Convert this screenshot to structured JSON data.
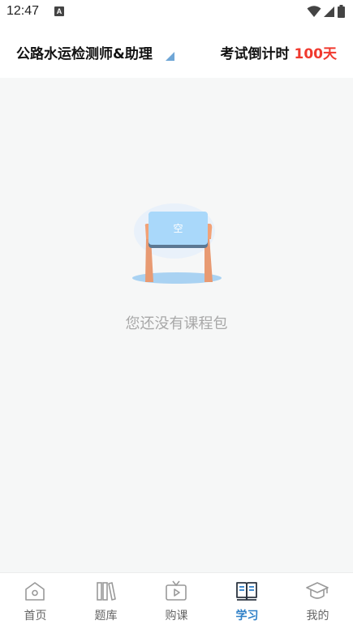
{
  "status_bar": {
    "time": "12:47",
    "notification_letter": "A"
  },
  "header": {
    "exam_title": "公路水运检测师&助理",
    "countdown_label": "考试倒计时",
    "countdown_days": "100天"
  },
  "empty_state": {
    "sign_text": "空",
    "message": "您还没有课程包"
  },
  "tabbar": {
    "tabs": [
      {
        "label": "首页",
        "icon": "home-icon"
      },
      {
        "label": "题库",
        "icon": "books-icon"
      },
      {
        "label": "购课",
        "icon": "tv-play-icon"
      },
      {
        "label": "学习",
        "icon": "open-book-icon",
        "active": true
      },
      {
        "label": "我的",
        "icon": "graduation-cap-icon"
      }
    ]
  },
  "colors": {
    "accent": "#2f80c8",
    "countdown": "#f0392e",
    "background": "#f6f7f7"
  }
}
